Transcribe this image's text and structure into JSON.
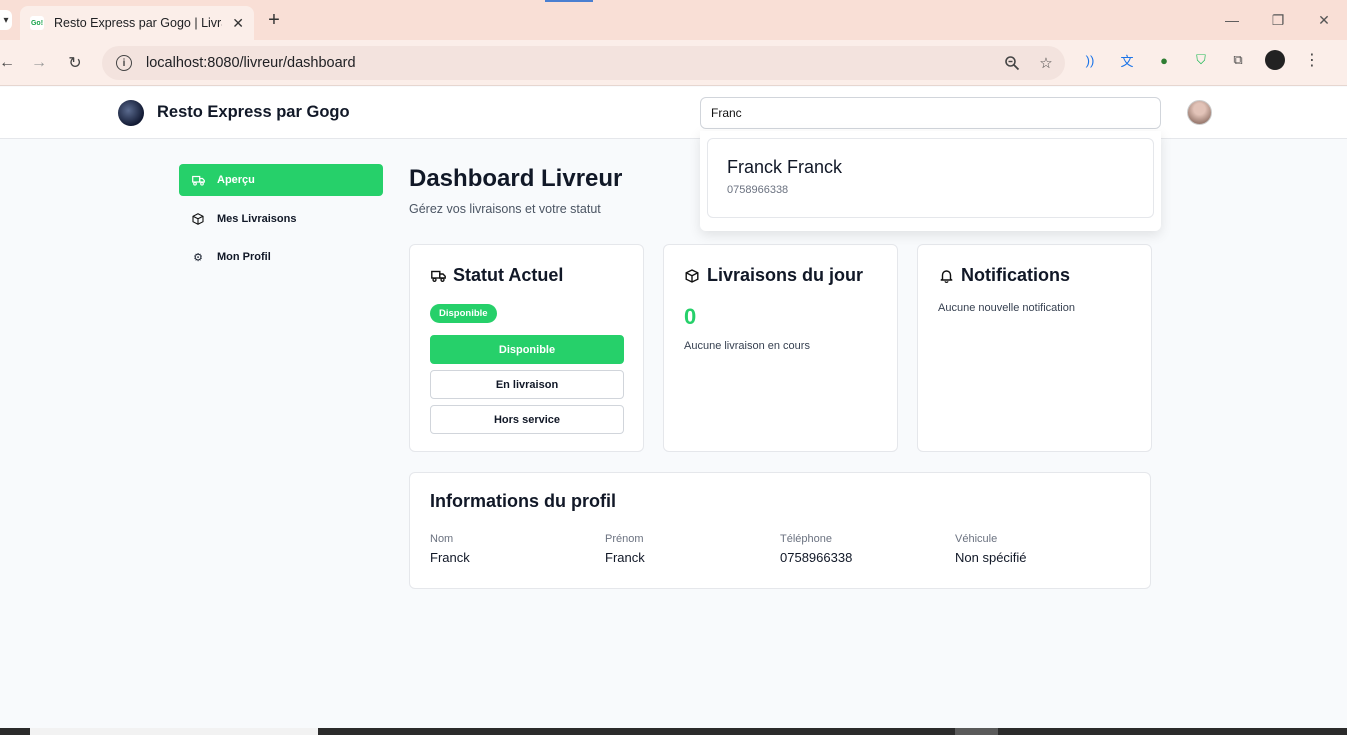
{
  "browser": {
    "tab_title": "Resto Express par Gogo | Livraison",
    "favicon_text": "Go!",
    "url": "localhost:8080/livreur/dashboard"
  },
  "header": {
    "brand": "Resto Express par Gogo",
    "search_value": "Franc"
  },
  "search_results": [
    {
      "name": "Franck Franck",
      "phone": "0758966338"
    }
  ],
  "sidebar": {
    "items": [
      {
        "label": "Aperçu",
        "icon": "truck-icon",
        "active": true
      },
      {
        "label": "Mes Livraisons",
        "icon": "package-icon",
        "active": false
      },
      {
        "label": "Mon Profil",
        "icon": "gear-icon",
        "active": false
      }
    ]
  },
  "main": {
    "title": "Dashboard Livreur",
    "subtitle": "Gérez vos livraisons et votre statut"
  },
  "status_card": {
    "title": "Statut Actuel",
    "badge": "Disponible",
    "buttons": [
      "Disponible",
      "En livraison",
      "Hors service"
    ]
  },
  "deliveries_card": {
    "title": "Livraisons du jour",
    "count": "0",
    "text": "Aucune livraison en cours"
  },
  "notifications_card": {
    "title": "Notifications",
    "text": "Aucune nouvelle notification"
  },
  "profile": {
    "title": "Informations du profil",
    "fields": [
      {
        "label": "Nom",
        "value": "Franck"
      },
      {
        "label": "Prénom",
        "value": "Franck"
      },
      {
        "label": "Téléphone",
        "value": "0758966338"
      },
      {
        "label": "Véhicule",
        "value": "Non spécifié"
      }
    ]
  },
  "colors": {
    "accent": "#26d06a",
    "browser_tabbar": "#f9dfd6",
    "background": "#f8fafc"
  }
}
